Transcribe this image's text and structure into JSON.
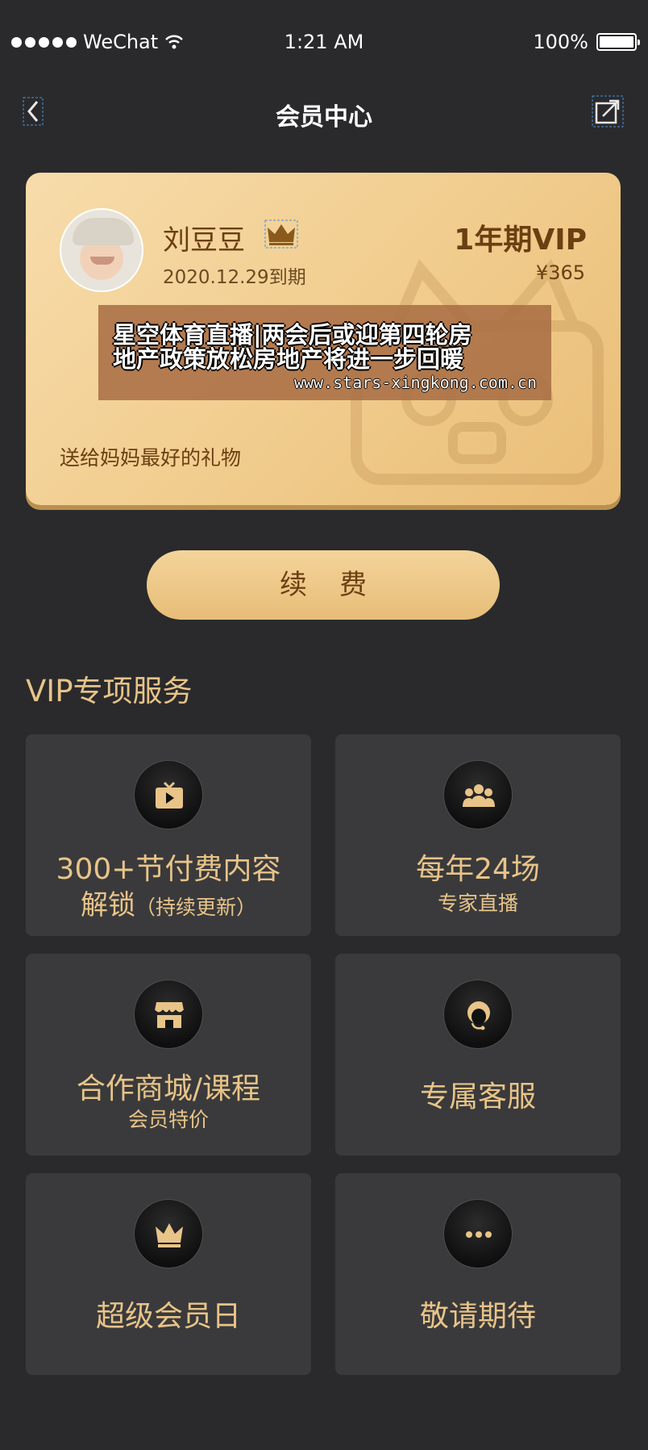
{
  "status_bar": {
    "carrier": "WeChat",
    "time": "1:21 AM",
    "battery": "100%"
  },
  "nav": {
    "title": "会员中心"
  },
  "card": {
    "user_name": "刘豆豆",
    "expiry": "2020.12.29到期",
    "plan": "1年期VIP",
    "price": "¥365",
    "gift_text": "送给妈妈最好的礼物"
  },
  "ad_overlay": {
    "line1": "星空体育直播|两会后或迎第四轮房",
    "line2": "地产政策放松房地产将进一步回暖",
    "url": "www.stars-xingkong.com.cn"
  },
  "renew_button": "续费",
  "section_title": "VIP专项服务",
  "services": [
    {
      "icon": "tv-icon",
      "title": "300+节付费内容",
      "sub_main": "解锁",
      "sub_note": "（持续更新）"
    },
    {
      "icon": "group-icon",
      "title": "每年24场",
      "sub": "专家直播"
    },
    {
      "icon": "store-icon",
      "title": "合作商城/课程",
      "sub": "会员特价"
    },
    {
      "icon": "customer-service-icon",
      "title": "专属客服",
      "sub": ""
    },
    {
      "icon": "crown-icon",
      "title": "超级会员日",
      "sub": ""
    },
    {
      "icon": "more-icon",
      "title": "敬请期待",
      "sub": ""
    }
  ],
  "colors": {
    "background": "#2a2a2c",
    "gold": "#e8c489",
    "card_gold": "#f2cf92",
    "brown_text": "#6b3f12",
    "tile": "#3a3a3c"
  }
}
